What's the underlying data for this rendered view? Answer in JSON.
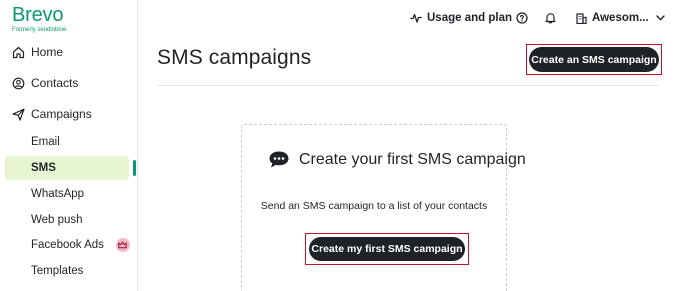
{
  "brand": {
    "name": "Brevo",
    "subtitle": "Formerly sendinblue",
    "color": "#0b996e"
  },
  "sidebar": {
    "items": [
      {
        "label": "Home",
        "icon": "home-icon"
      },
      {
        "label": "Contacts",
        "icon": "contacts-icon"
      },
      {
        "label": "Campaigns",
        "icon": "send-icon"
      }
    ],
    "campaign_subitems": [
      {
        "label": "Email"
      },
      {
        "label": "SMS",
        "active": true
      },
      {
        "label": "WhatsApp"
      },
      {
        "label": "Web push"
      },
      {
        "label": "Facebook Ads",
        "badge_icon": "crown-icon"
      },
      {
        "label": "Templates"
      }
    ]
  },
  "topbar": {
    "usage_label": "Usage and plan",
    "account_label": "Awesom..."
  },
  "main": {
    "title": "SMS campaigns",
    "create_button": "Create an SMS campaign",
    "empty_state": {
      "title": "Create your first SMS campaign",
      "description": "Send an SMS campaign to a list of your contacts",
      "button": "Create my first SMS campaign"
    }
  },
  "colors": {
    "accent": "#0b996e",
    "active_bg": "#e8f5d3",
    "button_dark": "#1f2328",
    "highlight": "#c8102e"
  }
}
